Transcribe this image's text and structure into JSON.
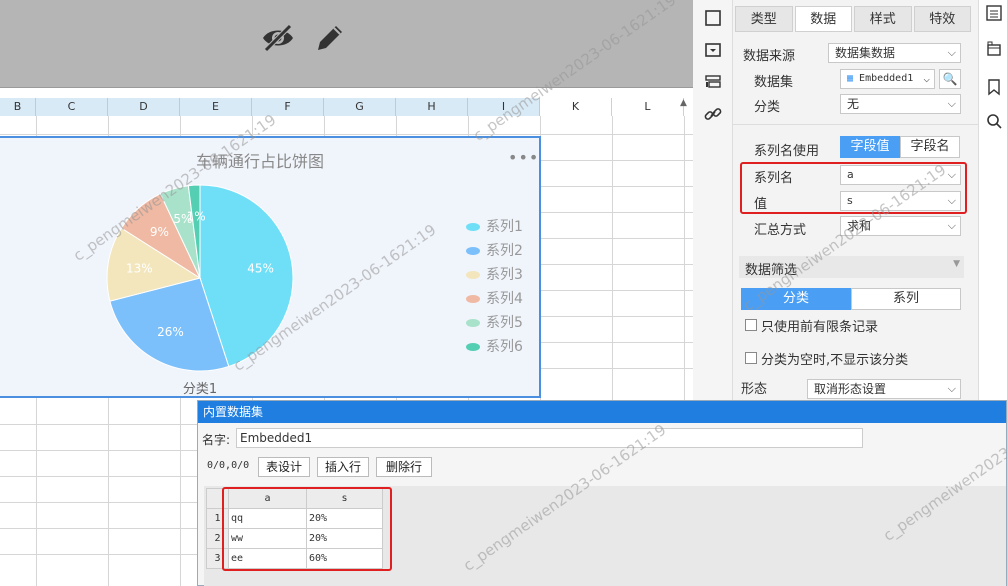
{
  "toolbar": {
    "hide_icon": "eye-off-icon",
    "edit_icon": "pencil-icon"
  },
  "sheet": {
    "columns": [
      "B",
      "C",
      "D",
      "E",
      "F",
      "G",
      "H",
      "I",
      "K",
      "L"
    ]
  },
  "chart_data": {
    "type": "pie",
    "title": "车辆通行占比饼图",
    "xlabel": "分类1",
    "menu_glyph": "•••",
    "slices": [
      {
        "label": "45%",
        "value": 45,
        "color": "#6fdff7"
      },
      {
        "label": "26%",
        "value": 26,
        "color": "#7cc0fb"
      },
      {
        "label": "13%",
        "value": 13,
        "color": "#f3e6bd"
      },
      {
        "label": "9%",
        "value": 9,
        "color": "#efb9a3"
      },
      {
        "label": "5%",
        "value": 5,
        "color": "#a9e2cb"
      },
      {
        "label": "1%",
        "value": 2,
        "color": "#55cfb4"
      }
    ],
    "legend": [
      "系列1",
      "系列2",
      "系列3",
      "系列4",
      "系列5",
      "系列6"
    ],
    "legend_position": "right"
  },
  "panel": {
    "tabs": [
      "类型",
      "数据",
      "样式",
      "特效"
    ],
    "data_source_label": "数据来源",
    "data_source_value": "数据集数据",
    "dataset_label": "数据集",
    "dataset_value": "Embedded1",
    "category_label": "分类",
    "category_value": "无",
    "series_name_use_label": "系列名使用",
    "seg_field_value": "字段值",
    "seg_field_name": "字段名",
    "series_name_label": "系列名",
    "series_name_value": "a",
    "value_label": "值",
    "value_value": "s",
    "summary_label": "汇总方式",
    "summary_value": "求和",
    "filter_label": "数据筛选",
    "seg_category": "分类",
    "seg_series": "系列",
    "only_top_label": "只使用前有限条记录",
    "empty_category_label": "分类为空时,不显示该分类",
    "shape_label": "形态",
    "shape_value": "取消形态设置"
  },
  "dialog": {
    "title": "内置数据集",
    "name_label": "名字:",
    "name_value": "Embedded1",
    "counter": "0/0,0/0",
    "btn_design": "表设计",
    "btn_insert": "插入行",
    "btn_delete": "删除行",
    "table": {
      "headers": [
        "a",
        "s"
      ],
      "rows": [
        {
          "n": "1",
          "a": "qq",
          "s": "20%"
        },
        {
          "n": "2",
          "a": "ww",
          "s": "20%"
        },
        {
          "n": "3",
          "a": "ee",
          "s": "60%"
        }
      ]
    }
  },
  "watermark": "c_pengmeiwen2023-06-1621:19",
  "colors": {
    "accent": "#1f7ee0",
    "highlight": "#e02020",
    "segment_on": "#4a9ff5"
  }
}
